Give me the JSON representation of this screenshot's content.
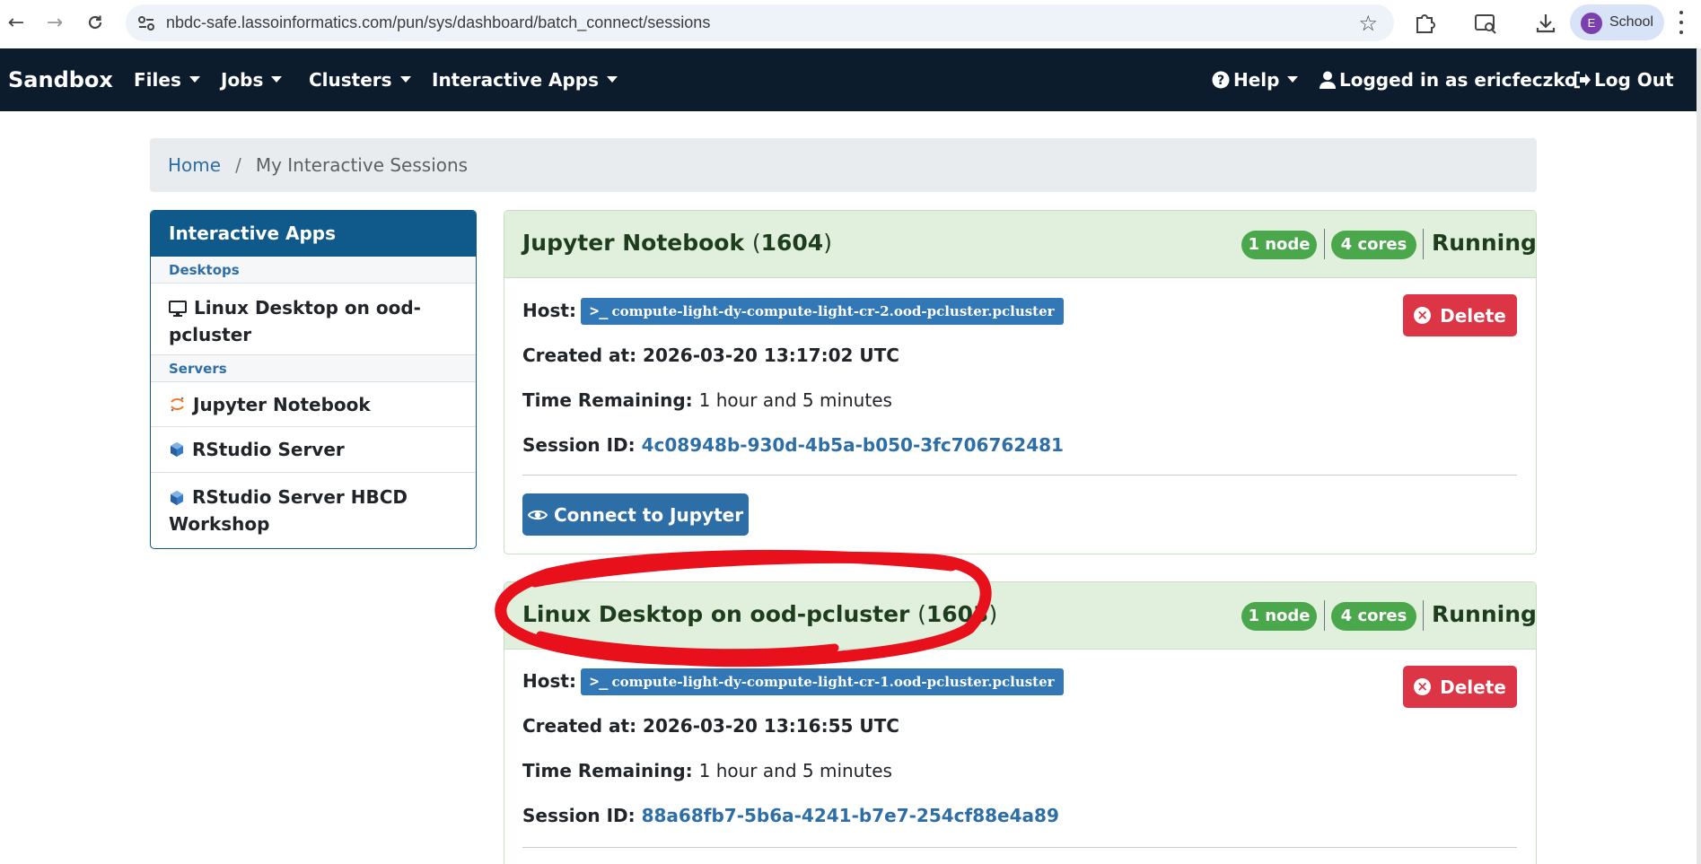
{
  "browser": {
    "url": "nbdc-safe.lassoinformatics.com/pun/sys/dashboard/batch_connect/sessions",
    "profile": {
      "initial": "E",
      "label": "School",
      "color": "#7b3fae"
    }
  },
  "navbar": {
    "brand": "Sandbox",
    "menus": [
      "Files",
      "Jobs",
      "Clusters",
      "Interactive Apps"
    ],
    "help": "Help",
    "logged_in": "Logged in as ericfeczko",
    "logout": "Log Out",
    "bg_color": "#0c1c2c"
  },
  "breadcrumb": {
    "home": "Home",
    "separator": "/",
    "current": "My Interactive Sessions"
  },
  "sidebar": {
    "title": "Interactive Apps",
    "categories": [
      {
        "name": "Desktops",
        "items": [
          {
            "label": "Linux Desktop on ood-pcluster",
            "icon": "monitor-icon"
          }
        ]
      },
      {
        "name": "Servers",
        "items": [
          {
            "label": "Jupyter Notebook",
            "icon": "jupyter-icon"
          },
          {
            "label": "RStudio Server",
            "icon": "rstudio-icon"
          },
          {
            "label": "RStudio Server HBCD Workshop",
            "icon": "rstudio-icon"
          }
        ]
      }
    ]
  },
  "sessions": [
    {
      "name": "Jupyter Notebook",
      "id": "1604",
      "nodes": "1 node",
      "cores": "4 cores",
      "status": "Running",
      "host_label": "Host:",
      "host": "compute-light-dy-compute-light-cr-2.ood-pcluster.pcluster",
      "created_label": "Created at:",
      "created": "2026-03-20 13:17:02 UTC",
      "remaining_label": "Time Remaining:",
      "remaining": "1 hour and 5 minutes",
      "session_label": "Session ID:",
      "session_id": "4c08948b-930d-4b5a-b050-3fc706762481",
      "delete": "Delete",
      "connect": "Connect to Jupyter"
    },
    {
      "name": "Linux Desktop on ood-pcluster",
      "id": "1603",
      "nodes": "1 node",
      "cores": "4 cores",
      "status": "Running",
      "host_label": "Host:",
      "host": "compute-light-dy-compute-light-cr-1.ood-pcluster.pcluster",
      "created_label": "Created at:",
      "created": "2026-03-20 13:16:55 UTC",
      "remaining_label": "Time Remaining:",
      "remaining": "1 hour and 5 minutes",
      "session_label": "Session ID:",
      "session_id": "88a68fb7-5b6a-4241-b7e7-254cf88e4a89",
      "delete": "Delete"
    }
  ],
  "colors": {
    "card_header": "#e1f0dc",
    "badge": "#4aa74b",
    "link": "#2e6ea6",
    "danger": "#dc3545",
    "annotation": "#e8101a"
  }
}
